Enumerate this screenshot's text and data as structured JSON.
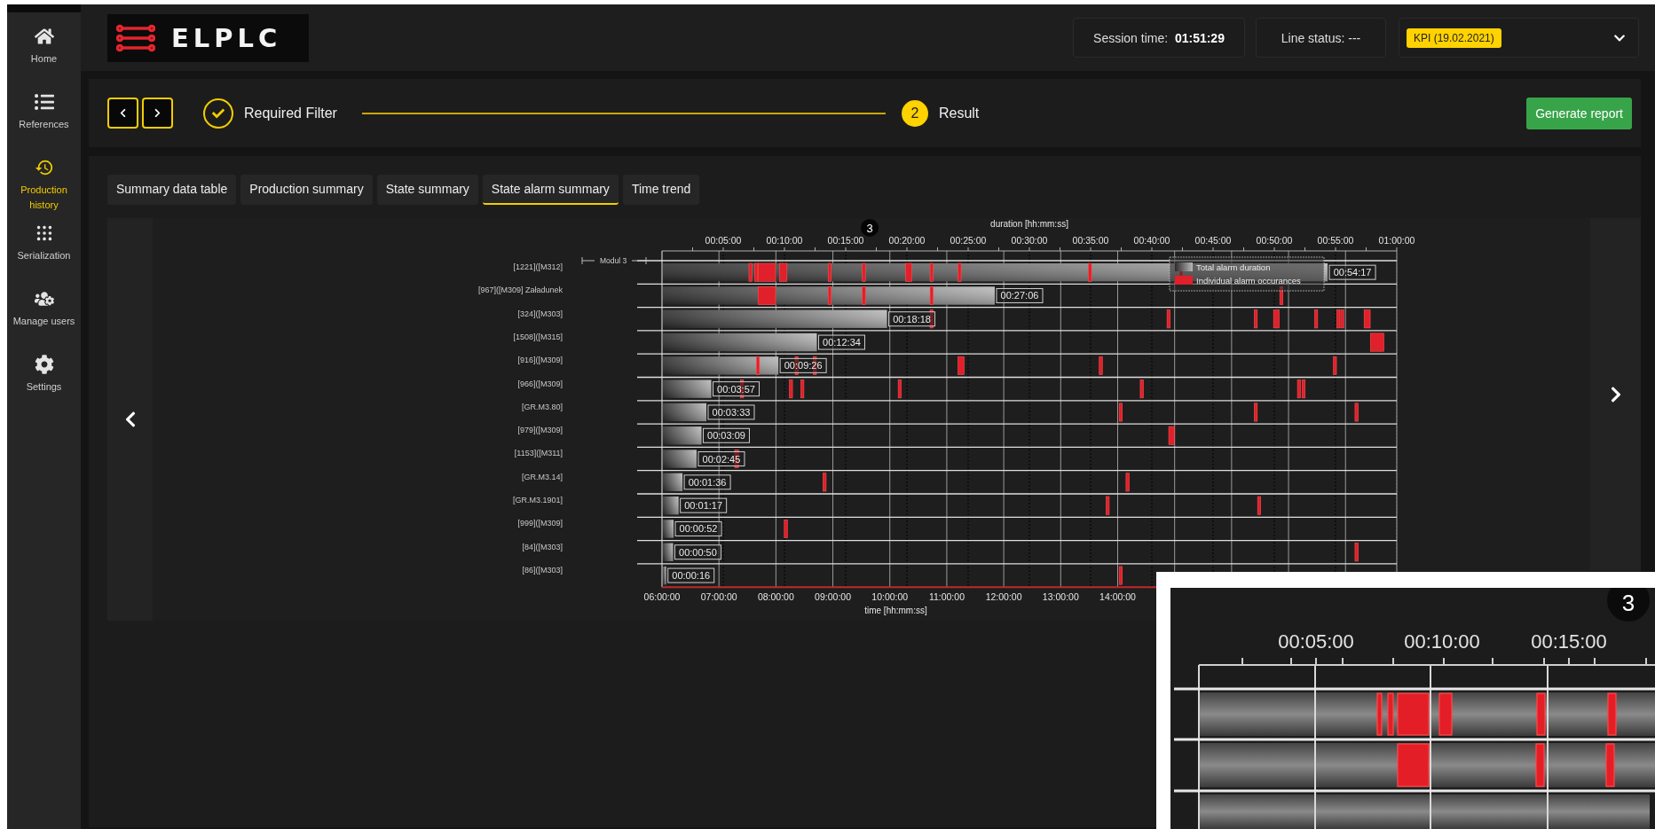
{
  "sidebar": {
    "items": [
      {
        "label": "Home",
        "selected": false
      },
      {
        "label": "References",
        "selected": false
      },
      {
        "label": "Production history",
        "selected": true
      },
      {
        "label": "Serialization",
        "selected": false
      },
      {
        "label": "Manage users",
        "selected": false
      },
      {
        "label": "Settings",
        "selected": false
      }
    ]
  },
  "header": {
    "logo": "ELPLC",
    "session": {
      "label": "Session time:",
      "value": "01:51:29"
    },
    "line_status": "Line status: ---",
    "report_select": {
      "value": "KPI (19.02.2021)"
    }
  },
  "stepper": {
    "steps": [
      {
        "label": "Required Filter",
        "done": true
      },
      {
        "label": "Result",
        "number": "2",
        "done": false
      }
    ]
  },
  "generate_button": "Generate report",
  "tabs": [
    {
      "label": "Summary data table",
      "selected": false
    },
    {
      "label": "Production summary",
      "selected": false
    },
    {
      "label": "State summary",
      "selected": false
    },
    {
      "label": "State alarm summary",
      "selected": true
    },
    {
      "label": "Time trend",
      "selected": false
    }
  ],
  "chart": {
    "badge": "3",
    "group_label": "Modul 3",
    "time_axis": {
      "label": "time [hh:mm:ss]",
      "ticks": [
        "06:00:00",
        "07:00:00",
        "08:00:00",
        "09:00:00",
        "10:00:00",
        "11:00:00",
        "12:00:00",
        "13:00:00",
        "14:00:00"
      ]
    },
    "occurrence_series": {
      "name": "Individual alarm occurances",
      "color": "#e0202a"
    },
    "chart_data": {
      "type": "bar",
      "orientation": "horizontal",
      "grid": true,
      "xlabel": "duration [hh:mm:ss]",
      "xlim": [
        0,
        60
      ],
      "categories": [
        "[1221]([M312]",
        "[967]([M309] Załadunek",
        "[324]([M303]",
        "[1508]([M315]",
        "[916]([M309]",
        "[966]([M309]",
        "[GR.M3.80]",
        "[979]([M309]",
        "[1153]([M311]",
        "[GR.M3.14]",
        "[GR.M3.1901]",
        "[999]([M309]",
        "[84]([M303]",
        "[86]([M303]"
      ],
      "series": [
        {
          "name": "Total alarm duration",
          "color": "#b8b8b8",
          "values": [
            54.28,
            27.1,
            18.3,
            12.57,
            9.43,
            3.95,
            3.55,
            3.15,
            2.75,
            1.6,
            1.28,
            0.87,
            0.83,
            0.27
          ]
        }
      ],
      "value_labels": [
        "00:54:17",
        "00:27:06",
        "00:18:18",
        "00:12:34",
        "00:09:26",
        "00:03:57",
        "00:03:33",
        "00:03:09",
        "00:02:45",
        "00:01:36",
        "00:01:17",
        "00:00:52",
        "00:00:50",
        "00:00:16"
      ],
      "xticks": [
        {
          "value": 5,
          "label": "00:05:00"
        },
        {
          "value": 10,
          "label": "00:10:00"
        },
        {
          "value": 15,
          "label": "00:15:00"
        },
        {
          "value": 20,
          "label": "00:20:00"
        },
        {
          "value": 25,
          "label": "00:25:00"
        },
        {
          "value": 30,
          "label": "00:30:00"
        },
        {
          "value": 35,
          "label": "00:35:00"
        },
        {
          "value": 40,
          "label": "00:40:00"
        },
        {
          "value": 45,
          "label": "00:45:00"
        },
        {
          "value": 50,
          "label": "00:50:00"
        },
        {
          "value": 55,
          "label": "00:55:00"
        },
        {
          "value": 60,
          "label": "01:00:00"
        }
      ]
    }
  },
  "inset": {
    "badge": "3",
    "ticks": [
      "00:05:00",
      "00:10:00",
      "00:15:00"
    ]
  }
}
